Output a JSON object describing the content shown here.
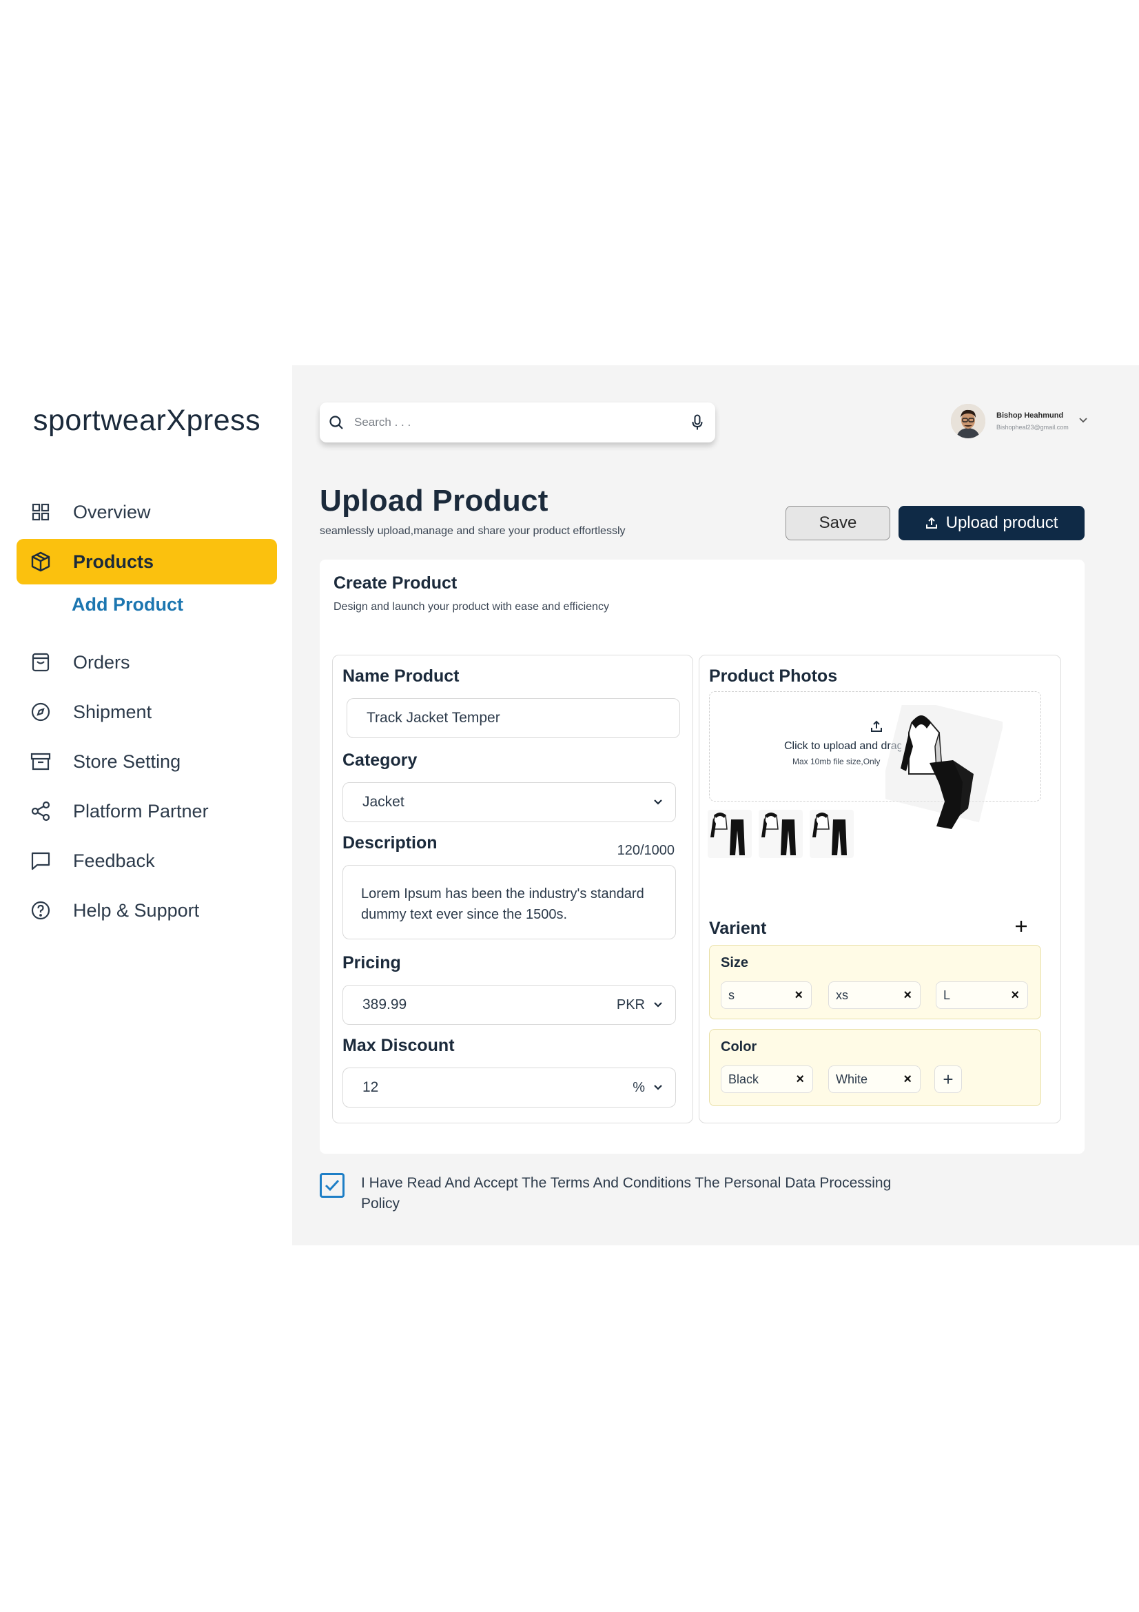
{
  "app": {
    "logo": "sportwearXpress"
  },
  "sidebar": {
    "items": [
      {
        "label": "Overview",
        "icon": "grid-icon",
        "active": false
      },
      {
        "label": "Products",
        "icon": "box-icon",
        "active": true
      },
      {
        "label": "Orders",
        "icon": "bag-icon",
        "active": false
      },
      {
        "label": "Shipment",
        "icon": "compass-icon",
        "active": false
      },
      {
        "label": "Store Setting",
        "icon": "archive-icon",
        "active": false
      },
      {
        "label": "Platform Partner",
        "icon": "share-icon",
        "active": false
      },
      {
        "label": "Feedback",
        "icon": "chat-icon",
        "active": false
      },
      {
        "label": "Help & Support",
        "icon": "help-icon",
        "active": false
      }
    ],
    "sub_item": "Add Product"
  },
  "header": {
    "search_placeholder": "Search . . .",
    "user_name": "Bishop Heahmund",
    "user_email": "Bishopheal23@gmail.com"
  },
  "page": {
    "title": "Upload Product",
    "subtitle": "seamlessly upload,manage and share your product effortlessly",
    "save_label": "Save",
    "upload_label": "Upload product"
  },
  "card": {
    "title": "Create Product",
    "subtitle": "Design and launch your product with ease and efficiency"
  },
  "form": {
    "name_label": "Name Product",
    "name_value": "Track Jacket Temper",
    "category_label": "Category",
    "category_value": "Jacket",
    "description_label": "Description",
    "description_counter": "120/1000",
    "description_value": "Lorem Ipsum has been the industry's standard dummy text ever since the 1500s.",
    "pricing_label": "Pricing",
    "pricing_value": "389.99",
    "pricing_currency": "PKR",
    "discount_label": "Max Discount",
    "discount_value": "12",
    "discount_unit": "%"
  },
  "photos": {
    "label": "Product Photos",
    "upload_text": "Click to upload and drag",
    "upload_sub": "Max 10mb file size,Only"
  },
  "variant": {
    "label": "Varient",
    "size_label": "Size",
    "sizes": [
      "s",
      "xs",
      "L"
    ],
    "color_label": "Color",
    "colors": [
      "Black",
      "White"
    ]
  },
  "terms": {
    "checked": true,
    "text": "I Have Read And Accept The Terms And Conditions The Personal Data Processing Policy"
  },
  "colors": {
    "accent": "#fbc10e",
    "primary": "#0f2a46",
    "link": "#1c76b0",
    "variant_bg": "#fffbe6"
  }
}
